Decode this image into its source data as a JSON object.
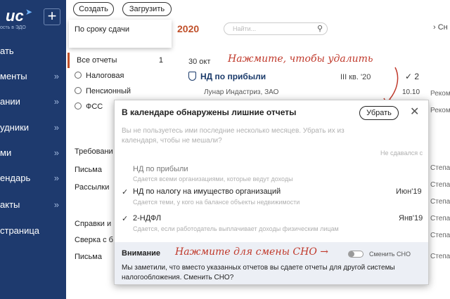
{
  "sidebar": {
    "brand": "uc",
    "brand_sub": "ость в ЭДО",
    "add_label": "+",
    "items": [
      {
        "label": "ать",
        "chevron": ""
      },
      {
        "label": "менты",
        "chevron": "»"
      },
      {
        "label": "ании",
        "chevron": "»"
      },
      {
        "label": "удники",
        "chevron": "»"
      },
      {
        "label": "ми",
        "chevron": "»"
      },
      {
        "label": "ендарь",
        "chevron": "»"
      },
      {
        "label": "акты",
        "chevron": "»"
      },
      {
        "label": "страница",
        "chevron": ""
      }
    ]
  },
  "toolbar": {
    "create_label": "Создать",
    "upload_label": "Загрузить"
  },
  "filter": {
    "label": "По сроку сдачи"
  },
  "year": "2020",
  "search": {
    "placeholder": "Найти..."
  },
  "right_clip": {
    "top": "› Сн"
  },
  "left_list": {
    "all_label": "Все отчеты",
    "all_count": "1",
    "items": [
      {
        "label": "Налоговая"
      },
      {
        "label": "Пенсионный"
      },
      {
        "label": "ФСС"
      }
    ],
    "groups": [
      "Требовани",
      "Письма",
      "Рассылки",
      "Справки и",
      "Сверка с б",
      "Письма"
    ]
  },
  "report": {
    "date": "30 окт",
    "title": "НД по прибыли",
    "period": "III кв. '20",
    "check": "✓ 2",
    "company": "Лунар Индастриз, ЗАО",
    "date2": "10.10"
  },
  "bg_clips": [
    "Реком",
    "Реком",
    "Степа",
    "Степа",
    "Степа",
    "Степа",
    "Степа",
    "Степа"
  ],
  "annotations": {
    "delete_hint": "Нажмите, чтобы удалить",
    "sno_hint": "Нажмите для смены СНО →"
  },
  "modal": {
    "title": "В календаре обнаружены лишние отчеты",
    "remove_label": "Убрать",
    "close": "✕",
    "intro_line1": "Вы не пользуетесь ими последние несколько месяцев. Убрать их из",
    "intro_line2": "календаря, чтобы не мешали?",
    "col_head": "Не сдавался с",
    "rows": [
      {
        "title": "НД по прибыли",
        "checked": false,
        "date": "",
        "desc": "Сдается всеми организациями, которые ведут доходы"
      },
      {
        "title": "НД по налогу на имущество организаций",
        "checked": true,
        "date": "Июн'19",
        "desc": "Сдается теми, у кого на балансе объекты недвижимости"
      },
      {
        "title": "2-НДФЛ",
        "checked": true,
        "date": "Янв'19",
        "desc": "Сдается, если работодатель выплачивает доходы физическим лицам"
      }
    ],
    "warning": {
      "title": "Внимание",
      "toggle_label": "Сменить СНО",
      "text": "Мы заметили, что вместо указанных отчетов вы сдаете отчеты для другой системы налогообложения. Сменить СНО?"
    }
  }
}
